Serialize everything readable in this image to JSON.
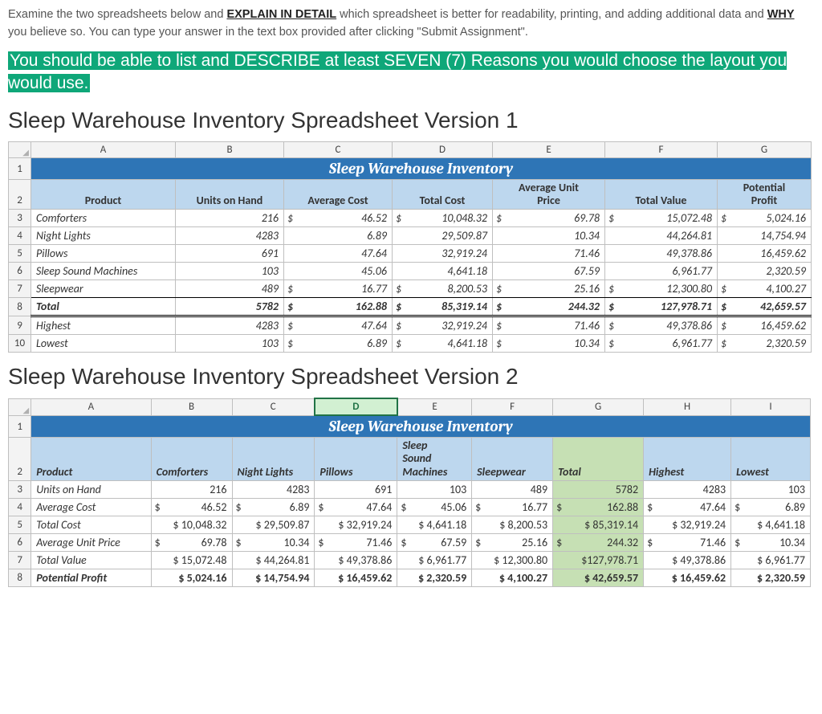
{
  "intro": {
    "line1a": "Examine the two spreadsheets below and ",
    "emph1": "EXPLAIN IN DETAIL",
    "line1b": " which spreadsheet is better for readability, printing, and adding additional data and ",
    "emph2": "WHY",
    "line1c": " you believe so. You can type your answer in the text box provided after clicking \"Submit Assignment\"."
  },
  "banner": "You should be able to list and DESCRIBE at least SEVEN (7) Reasons you would choose the layout you would use.",
  "v1": {
    "heading": "Sleep Warehouse Inventory Spreadsheet Version 1",
    "cols": [
      "A",
      "B",
      "C",
      "D",
      "E",
      "F",
      "G"
    ],
    "title": "Sleep Warehouse Inventory",
    "headers": [
      "Product",
      "Units on Hand",
      "Average Cost",
      "Total Cost",
      "Average Unit Price",
      "Total Value",
      "Potential Profit"
    ],
    "rows": [
      {
        "n": "3",
        "p": "Comforters",
        "u": "216",
        "ac": "46.52",
        "tc": "10,048.32",
        "aup": "69.78",
        "tv": "15,072.48",
        "pp": "5,024.16",
        "d": true
      },
      {
        "n": "4",
        "p": "Night Lights",
        "u": "4283",
        "ac": "6.89",
        "tc": "29,509.87",
        "aup": "10.34",
        "tv": "44,264.81",
        "pp": "14,754.94",
        "d": false
      },
      {
        "n": "5",
        "p": "Pillows",
        "u": "691",
        "ac": "47.64",
        "tc": "32,919.24",
        "aup": "71.46",
        "tv": "49,378.86",
        "pp": "16,459.62",
        "d": false
      },
      {
        "n": "6",
        "p": "Sleep Sound Machines",
        "u": "103",
        "ac": "45.06",
        "tc": "4,641.18",
        "aup": "67.59",
        "tv": "6,961.77",
        "pp": "2,320.59",
        "d": false
      },
      {
        "n": "7",
        "p": "Sleepwear",
        "u": "489",
        "ac": "16.77",
        "tc": "8,200.53",
        "aup": "25.16",
        "tv": "12,300.80",
        "pp": "4,100.27",
        "d": true
      }
    ],
    "total": {
      "n": "8",
      "p": "Total",
      "u": "5782",
      "ac": "162.88",
      "tc": "85,319.14",
      "aup": "244.32",
      "tv": "127,978.71",
      "pp": "42,659.57"
    },
    "highest": {
      "n": "9",
      "p": "Highest",
      "u": "4283",
      "ac": "47.64",
      "tc": "32,919.24",
      "aup": "71.46",
      "tv": "49,378.86",
      "pp": "16,459.62"
    },
    "lowest": {
      "n": "10",
      "p": "Lowest",
      "u": "103",
      "ac": "6.89",
      "tc": "4,641.18",
      "aup": "10.34",
      "tv": "6,961.77",
      "pp": "2,320.59"
    }
  },
  "v2": {
    "heading": "Sleep Warehouse Inventory Spreadsheet Version 2",
    "cols": [
      "A",
      "B",
      "C",
      "D",
      "E",
      "F",
      "G",
      "H",
      "I"
    ],
    "selected_col": "D",
    "title": "Sleep Warehouse Inventory",
    "col_labels": [
      "Product",
      "Comforters",
      "Night Lights",
      "Pillows",
      "Sleep Sound Machines",
      "Sleepwear",
      "Total",
      "Highest",
      "Lowest"
    ],
    "rows": [
      {
        "n": "3",
        "label": "Units on Hand",
        "vals": [
          "216",
          "4283",
          "691",
          "103",
          "489",
          "5782",
          "4283",
          "103"
        ],
        "d": false,
        "b": false
      },
      {
        "n": "4",
        "label": "Average Cost",
        "vals": [
          "46.52",
          "6.89",
          "47.64",
          "45.06",
          "16.77",
          "162.88",
          "47.64",
          "6.89"
        ],
        "d": true,
        "b": false
      },
      {
        "n": "5",
        "label": "Total Cost",
        "vals": [
          "$ 10,048.32",
          "$ 29,509.87",
          "$ 32,919.24",
          "$ 4,641.18",
          "$  8,200.53",
          "$  85,319.14",
          "$ 32,919.24",
          "$ 4,641.18"
        ],
        "d": false,
        "b": false
      },
      {
        "n": "6",
        "label": "Average Unit Price",
        "vals": [
          "69.78",
          "10.34",
          "71.46",
          "67.59",
          "25.16",
          "244.32",
          "71.46",
          "10.34"
        ],
        "d": true,
        "b": false
      },
      {
        "n": "7",
        "label": "Total Value",
        "vals": [
          "$ 15,072.48",
          "$ 44,264.81",
          "$ 49,378.86",
          "$ 6,961.77",
          "$ 12,300.80",
          "$127,978.71",
          "$ 49,378.86",
          "$ 6,961.77"
        ],
        "d": false,
        "b": false
      },
      {
        "n": "8",
        "label": "Potential Profit",
        "vals": [
          "$  5,024.16",
          "$ 14,754.94",
          "$ 16,459.62",
          "$ 2,320.59",
          "$  4,100.27",
          "$  42,659.57",
          "$ 16,459.62",
          "$ 2,320.59"
        ],
        "d": false,
        "b": true
      }
    ]
  }
}
